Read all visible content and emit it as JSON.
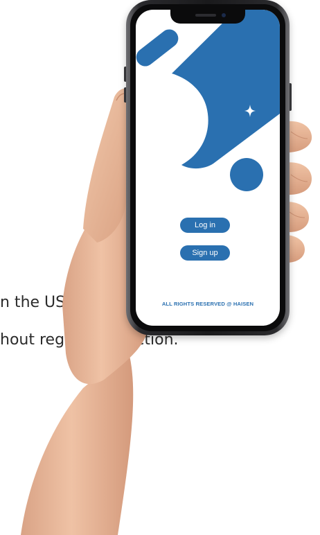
{
  "background_text": {
    "line1": "n the US.)",
    "line2": "hout region destriction."
  },
  "app": {
    "login_label": "Log in",
    "signup_label": "Sign up",
    "footer": "ALL RIGHTS RESERVED @ HAISEN"
  },
  "colors": {
    "brand_blue": "#2a70b0",
    "screen_bg": "#ffffff",
    "skin": "#e9b89a"
  },
  "icons": {
    "sparkle": "four-point-star-icon"
  }
}
